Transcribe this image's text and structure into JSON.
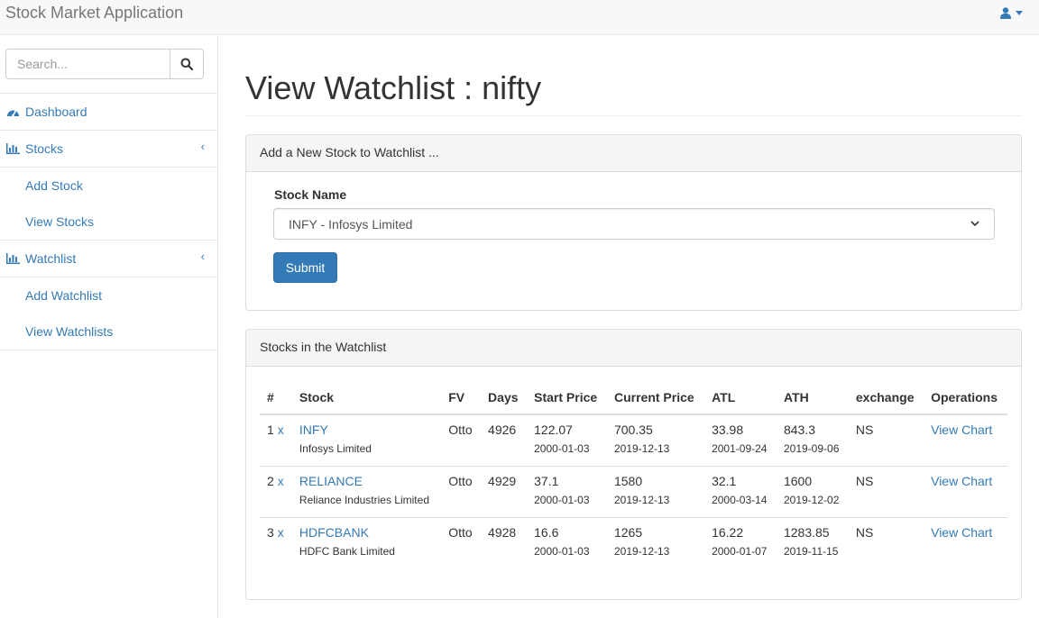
{
  "app": {
    "title": "Stock Market Application"
  },
  "header": {
    "user_icon": "user-icon"
  },
  "search": {
    "placeholder": "Search...",
    "value": ""
  },
  "sidebar": {
    "items": [
      {
        "label": "Dashboard",
        "icon": "dashboard-icon"
      },
      {
        "label": "Stocks",
        "icon": "bar-chart-icon",
        "children": [
          "Add Stock",
          "View Stocks"
        ]
      },
      {
        "label": "Watchlist",
        "icon": "bar-chart-icon",
        "children": [
          "Add Watchlist",
          "View Watchlists"
        ]
      }
    ]
  },
  "page": {
    "title": "View Watchlist : nifty"
  },
  "add_panel": {
    "heading": "Add a New Stock to Watchlist ...",
    "field_label": "Stock Name",
    "selected": "INFY - Infosys Limited",
    "submit_label": "Submit"
  },
  "list_panel": {
    "heading": "Stocks in the Watchlist",
    "columns": [
      "#",
      "Stock",
      "FV",
      "Days",
      "Start Price",
      "Current Price",
      "ATL",
      "ATH",
      "exchange",
      "Operations"
    ],
    "rows": [
      {
        "num": "1",
        "remove": "x",
        "symbol": "INFY",
        "name": "Infosys Limited",
        "fv": "Otto",
        "days": "4926",
        "start_price": "122.07",
        "start_date": "2000-01-03",
        "current_price": "700.35",
        "current_date": "2019-12-13",
        "atl": "33.98",
        "atl_date": "2001-09-24",
        "ath": "843.3",
        "ath_date": "2019-09-06",
        "exchange": "NS",
        "op": "View Chart"
      },
      {
        "num": "2",
        "remove": "x",
        "symbol": "RELIANCE",
        "name": "Reliance Industries Limited",
        "fv": "Otto",
        "days": "4929",
        "start_price": "37.1",
        "start_date": "2000-01-03",
        "current_price": "1580",
        "current_date": "2019-12-13",
        "atl": "32.1",
        "atl_date": "2000-03-14",
        "ath": "1600",
        "ath_date": "2019-12-02",
        "exchange": "NS",
        "op": "View Chart"
      },
      {
        "num": "3",
        "remove": "x",
        "symbol": "HDFCBANK",
        "name": "HDFC Bank Limited",
        "fv": "Otto",
        "days": "4928",
        "start_price": "16.6",
        "start_date": "2000-01-03",
        "current_price": "1265",
        "current_date": "2019-12-13",
        "atl": "16.22",
        "atl_date": "2000-01-07",
        "ath": "1283.85",
        "ath_date": "2019-11-15",
        "exchange": "NS",
        "op": "View Chart"
      }
    ]
  },
  "colors": {
    "link": "#337ab7",
    "button": "#337ab7",
    "panel_heading_bg": "#f5f5f5",
    "navbar_bg": "#f8f8f8"
  }
}
